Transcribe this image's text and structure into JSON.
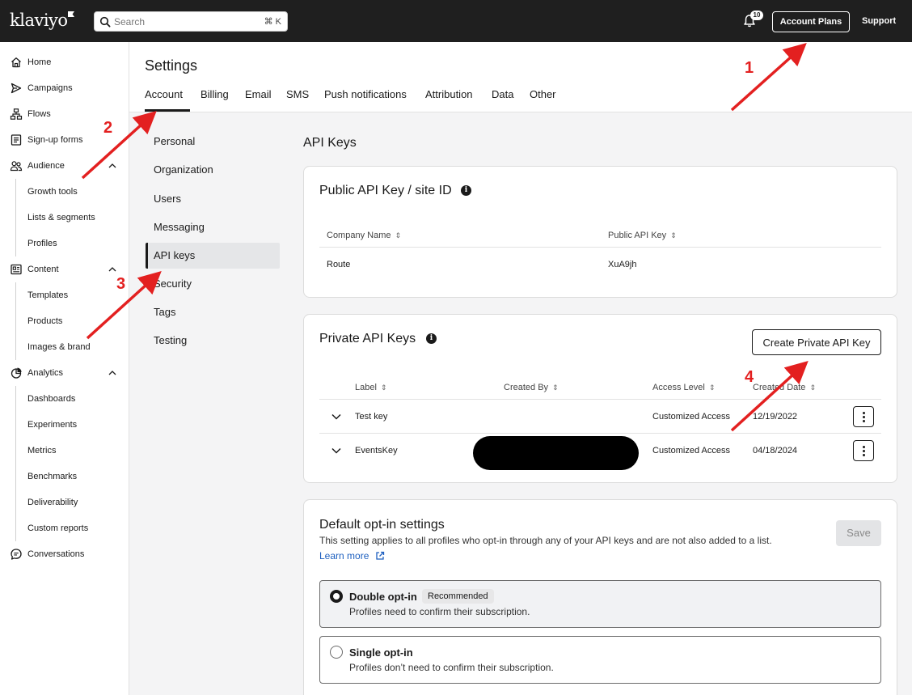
{
  "topbar": {
    "logo": "klaviyo",
    "search_placeholder": "Search",
    "search_shortcut": "⌘ K",
    "notification_count": "10",
    "account_plans": "Account Plans",
    "support": "Support"
  },
  "nav": {
    "home": "Home",
    "campaigns": "Campaigns",
    "flows": "Flows",
    "signup_forms": "Sign-up forms",
    "audience": "Audience",
    "audience_items": [
      "Growth tools",
      "Lists & segments",
      "Profiles"
    ],
    "content": "Content",
    "content_items": [
      "Templates",
      "Products",
      "Images & brand"
    ],
    "analytics": "Analytics",
    "analytics_items": [
      "Dashboards",
      "Experiments",
      "Metrics",
      "Benchmarks",
      "Deliverability",
      "Custom reports"
    ],
    "conversations": "Conversations"
  },
  "page": {
    "title": "Settings",
    "tabs": [
      "Account",
      "Billing",
      "Email",
      "SMS",
      "Push notifications",
      "Attribution",
      "Data",
      "Other"
    ],
    "active_tab": "Account"
  },
  "subnav": {
    "items": [
      "Personal",
      "Organization",
      "Users",
      "Messaging",
      "API keys",
      "Security",
      "Tags",
      "Testing"
    ],
    "active": "API keys"
  },
  "api": {
    "section_title": "API Keys",
    "public": {
      "title": "Public API Key / site ID",
      "col_company": "Company Name",
      "col_key": "Public API Key",
      "company": "Route",
      "key": "XuA9jh"
    },
    "private": {
      "title": "Private API Keys",
      "create_button": "Create Private API Key",
      "columns": [
        "Label",
        "Created By",
        "Access Level",
        "Created Date"
      ],
      "rows": [
        {
          "label": "Test key",
          "created_by": "",
          "access": "Customized Access",
          "date": "12/19/2022"
        },
        {
          "label": "EventsKey",
          "created_by": "",
          "access": "Customized Access",
          "date": "04/18/2024"
        }
      ]
    }
  },
  "optin": {
    "title": "Default opt-in settings",
    "description": "This setting applies to all profiles who opt-in through any of your API keys and are not also added to a list.",
    "learn_more": "Learn more",
    "save": "Save",
    "double_title": "Double opt-in",
    "double_badge": "Recommended",
    "double_desc": "Profiles need to confirm their subscription.",
    "single_title": "Single opt-in",
    "single_desc": "Profiles don’t need to confirm their subscription.",
    "selected": "Double opt-in"
  },
  "annotations": {
    "a1": "1",
    "a2": "2",
    "a3": "3",
    "a4": "4"
  },
  "colors": {
    "annotation": "#e32020",
    "topbar": "#1f1f1f",
    "link": "#1d5fbf"
  }
}
